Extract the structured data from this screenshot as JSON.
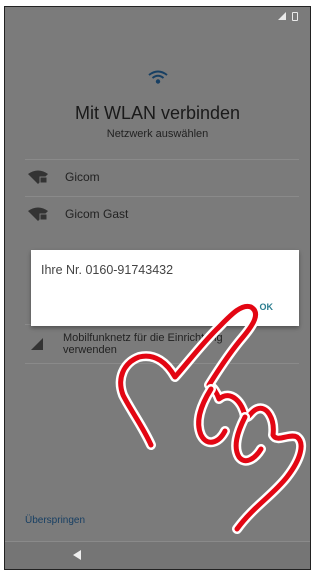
{
  "screen": {
    "title": "Mit WLAN verbinden",
    "subtitle": "Netzwerk auswählen",
    "header_icon": "wifi-icon"
  },
  "networks": [
    {
      "label": "Gicom",
      "icon": "wifi-lock-icon"
    },
    {
      "label": "Gicom Gast",
      "icon": "wifi-lock-icon"
    }
  ],
  "mobile_option": {
    "label": "Mobilfunknetz für die Einrichtung verwenden",
    "icon": "cellular-signal-icon"
  },
  "dialog": {
    "message": "Ihre Nr. 0160-91743432",
    "ok_label": "OK"
  },
  "skip_label": "Überspringen",
  "status_bar": {
    "icons": [
      "signal-icon",
      "battery-icon"
    ]
  },
  "nav_bar": {
    "icons": [
      "back-icon"
    ]
  },
  "overlay": {
    "type": "hand-pointer-drawing",
    "color": "#e30613"
  },
  "colors": {
    "dimmed_background": "#7b7b7b",
    "link": "#173f63",
    "dialog_button": "#2a7d8f"
  }
}
